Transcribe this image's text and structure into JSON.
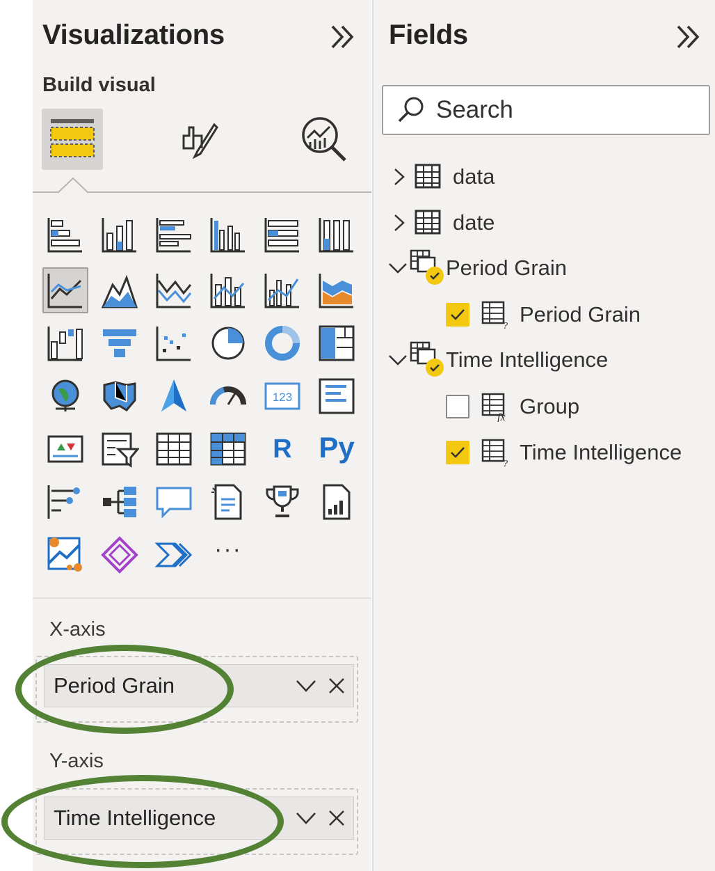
{
  "visualizations": {
    "title": "Visualizations",
    "build_label": "Build visual",
    "build_buttons": [
      {
        "name": "build-visual-tab",
        "icon": "table-fields-icon",
        "selected": true
      },
      {
        "name": "format-visual-tab",
        "icon": "paintbrush-icon"
      },
      {
        "name": "analytics-tab",
        "icon": "magnifier-chart-icon"
      }
    ],
    "icons": [
      {
        "name": "stacked-bar-chart-icon"
      },
      {
        "name": "stacked-column-chart-icon"
      },
      {
        "name": "clustered-bar-chart-icon"
      },
      {
        "name": "clustered-column-chart-icon"
      },
      {
        "name": "100-percent-stacked-bar-chart-icon"
      },
      {
        "name": "100-percent-stacked-column-chart-icon"
      },
      {
        "name": "line-chart-icon",
        "selected": true
      },
      {
        "name": "area-chart-icon"
      },
      {
        "name": "stacked-area-chart-icon"
      },
      {
        "name": "line-and-stacked-column-chart-icon"
      },
      {
        "name": "line-and-clustered-column-chart-icon"
      },
      {
        "name": "ribbon-chart-icon"
      },
      {
        "name": "waterfall-chart-icon"
      },
      {
        "name": "funnel-chart-icon"
      },
      {
        "name": "scatter-chart-icon"
      },
      {
        "name": "pie-chart-icon"
      },
      {
        "name": "donut-chart-icon"
      },
      {
        "name": "treemap-icon"
      },
      {
        "name": "map-icon"
      },
      {
        "name": "filled-map-icon"
      },
      {
        "name": "azure-map-icon"
      },
      {
        "name": "gauge-icon"
      },
      {
        "name": "card-icon"
      },
      {
        "name": "multi-row-card-icon"
      },
      {
        "name": "kpi-icon"
      },
      {
        "name": "slicer-icon"
      },
      {
        "name": "table-icon"
      },
      {
        "name": "matrix-icon"
      },
      {
        "name": "r-visual-icon",
        "text": "R"
      },
      {
        "name": "python-visual-icon",
        "text": "Py"
      },
      {
        "name": "key-influencers-icon"
      },
      {
        "name": "decomposition-tree-icon"
      },
      {
        "name": "qa-icon"
      },
      {
        "name": "smart-narrative-icon"
      },
      {
        "name": "metrics-icon"
      },
      {
        "name": "paginated-report-icon"
      },
      {
        "name": "arcgis-map-icon"
      },
      {
        "name": "power-apps-icon"
      },
      {
        "name": "power-automate-icon"
      },
      {
        "name": "more-visuals-icon",
        "text": "···"
      }
    ],
    "x_axis": {
      "label": "X-axis",
      "field": "Period Grain"
    },
    "y_axis": {
      "label": "Y-axis",
      "field": "Time Intelligence"
    }
  },
  "fields": {
    "title": "Fields",
    "search_placeholder": "Search",
    "tree": [
      {
        "label": "data",
        "type": "table",
        "expanded": false
      },
      {
        "label": "date",
        "type": "table",
        "expanded": false
      },
      {
        "label": "Period Grain",
        "type": "calc-group",
        "expanded": true,
        "children": [
          {
            "label": "Period Grain",
            "checked": true
          }
        ]
      },
      {
        "label": "Time Intelligence",
        "type": "calc-group",
        "expanded": true,
        "children": [
          {
            "label": "Group",
            "checked": false
          },
          {
            "label": "Time Intelligence",
            "checked": true
          }
        ]
      }
    ]
  },
  "colors": {
    "accent_yellow": "#f2c811",
    "icon_blue": "#1f6fc7",
    "annotation_green": "#548235"
  }
}
